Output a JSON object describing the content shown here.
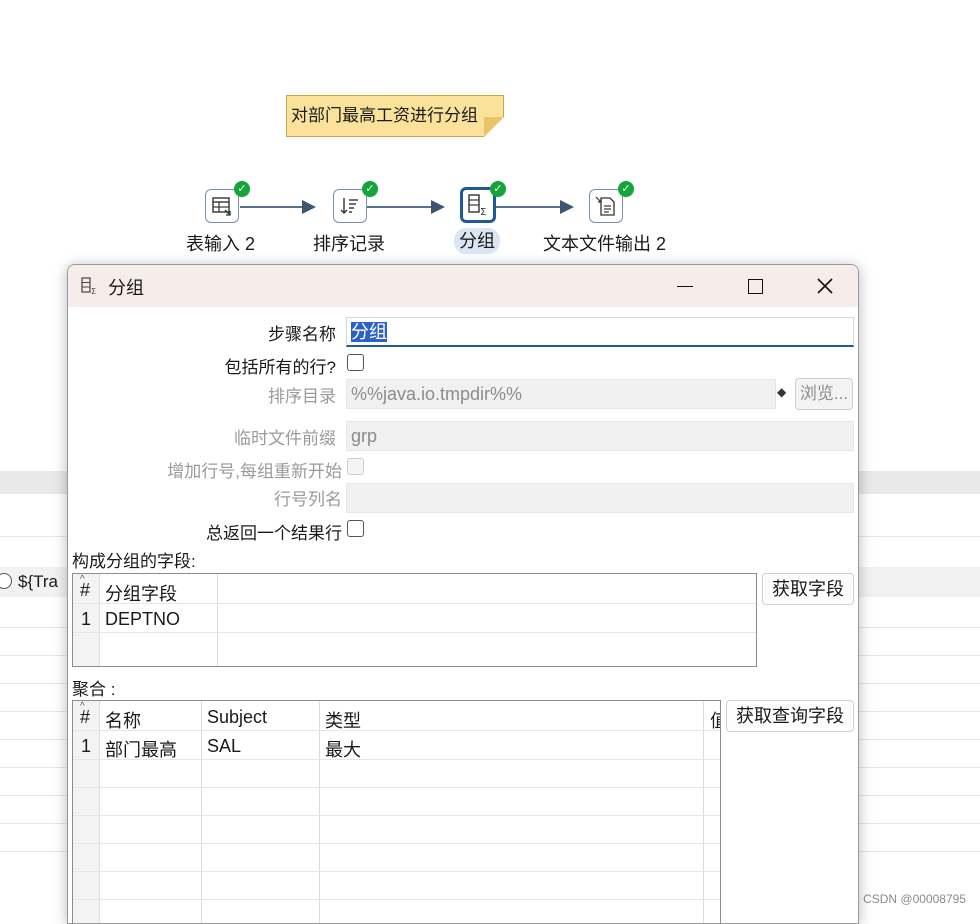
{
  "canvas": {
    "note_text": "对部门最高工资进行分组",
    "steps": [
      {
        "label": "表输入 2",
        "icon": "table-input-icon",
        "status": "ok"
      },
      {
        "label": "排序记录",
        "icon": "sort-rows-icon",
        "status": "ok"
      },
      {
        "label": "分组",
        "icon": "group-by-icon",
        "status": "ok",
        "selected": true
      },
      {
        "label": "文本文件输出 2",
        "icon": "text-file-output-icon",
        "status": "ok"
      }
    ],
    "background_row_text": "${Tra"
  },
  "dialog": {
    "title": "分组",
    "title_icon": "group-by-icon",
    "controls": {
      "minimize": "—",
      "maximize": "☐",
      "close": "✕"
    },
    "fields": {
      "step_name_label": "步骤名称",
      "step_name_value": "分组",
      "include_all_rows_label": "包括所有的行?",
      "sort_dir_label": "排序目录",
      "sort_dir_value": "%%java.io.tmpdir%%",
      "browse_button": "浏览...",
      "temp_prefix_label": "临时文件前缀",
      "temp_prefix_value": "grp",
      "add_line_number_label": "增加行号,每组重新开始",
      "line_number_field_label": "行号列名",
      "line_number_field_value": "",
      "always_one_row_label": "总返回一个结果行"
    },
    "group_section": {
      "label": "构成分组的字段:",
      "get_fields_button": "获取字段",
      "columns": [
        "#",
        "分组字段"
      ],
      "rows": [
        [
          "1",
          "DEPTNO"
        ]
      ]
    },
    "aggregate_section": {
      "label": "聚合 :",
      "get_lookup_button": "获取查询字段",
      "columns": [
        "#",
        "名称",
        "Subject",
        "类型",
        "值"
      ],
      "rows": [
        [
          "1",
          "部门最高",
          "SAL",
          "最大"
        ]
      ]
    }
  },
  "watermark": "CSDN @00008795",
  "colors": {
    "note_bg": "#fbe29a",
    "status_ok": "#14a53a",
    "selected_border": "#1e5b95",
    "titlebar_bg": "#f6ecea",
    "selection_bg": "#2a62c8"
  }
}
